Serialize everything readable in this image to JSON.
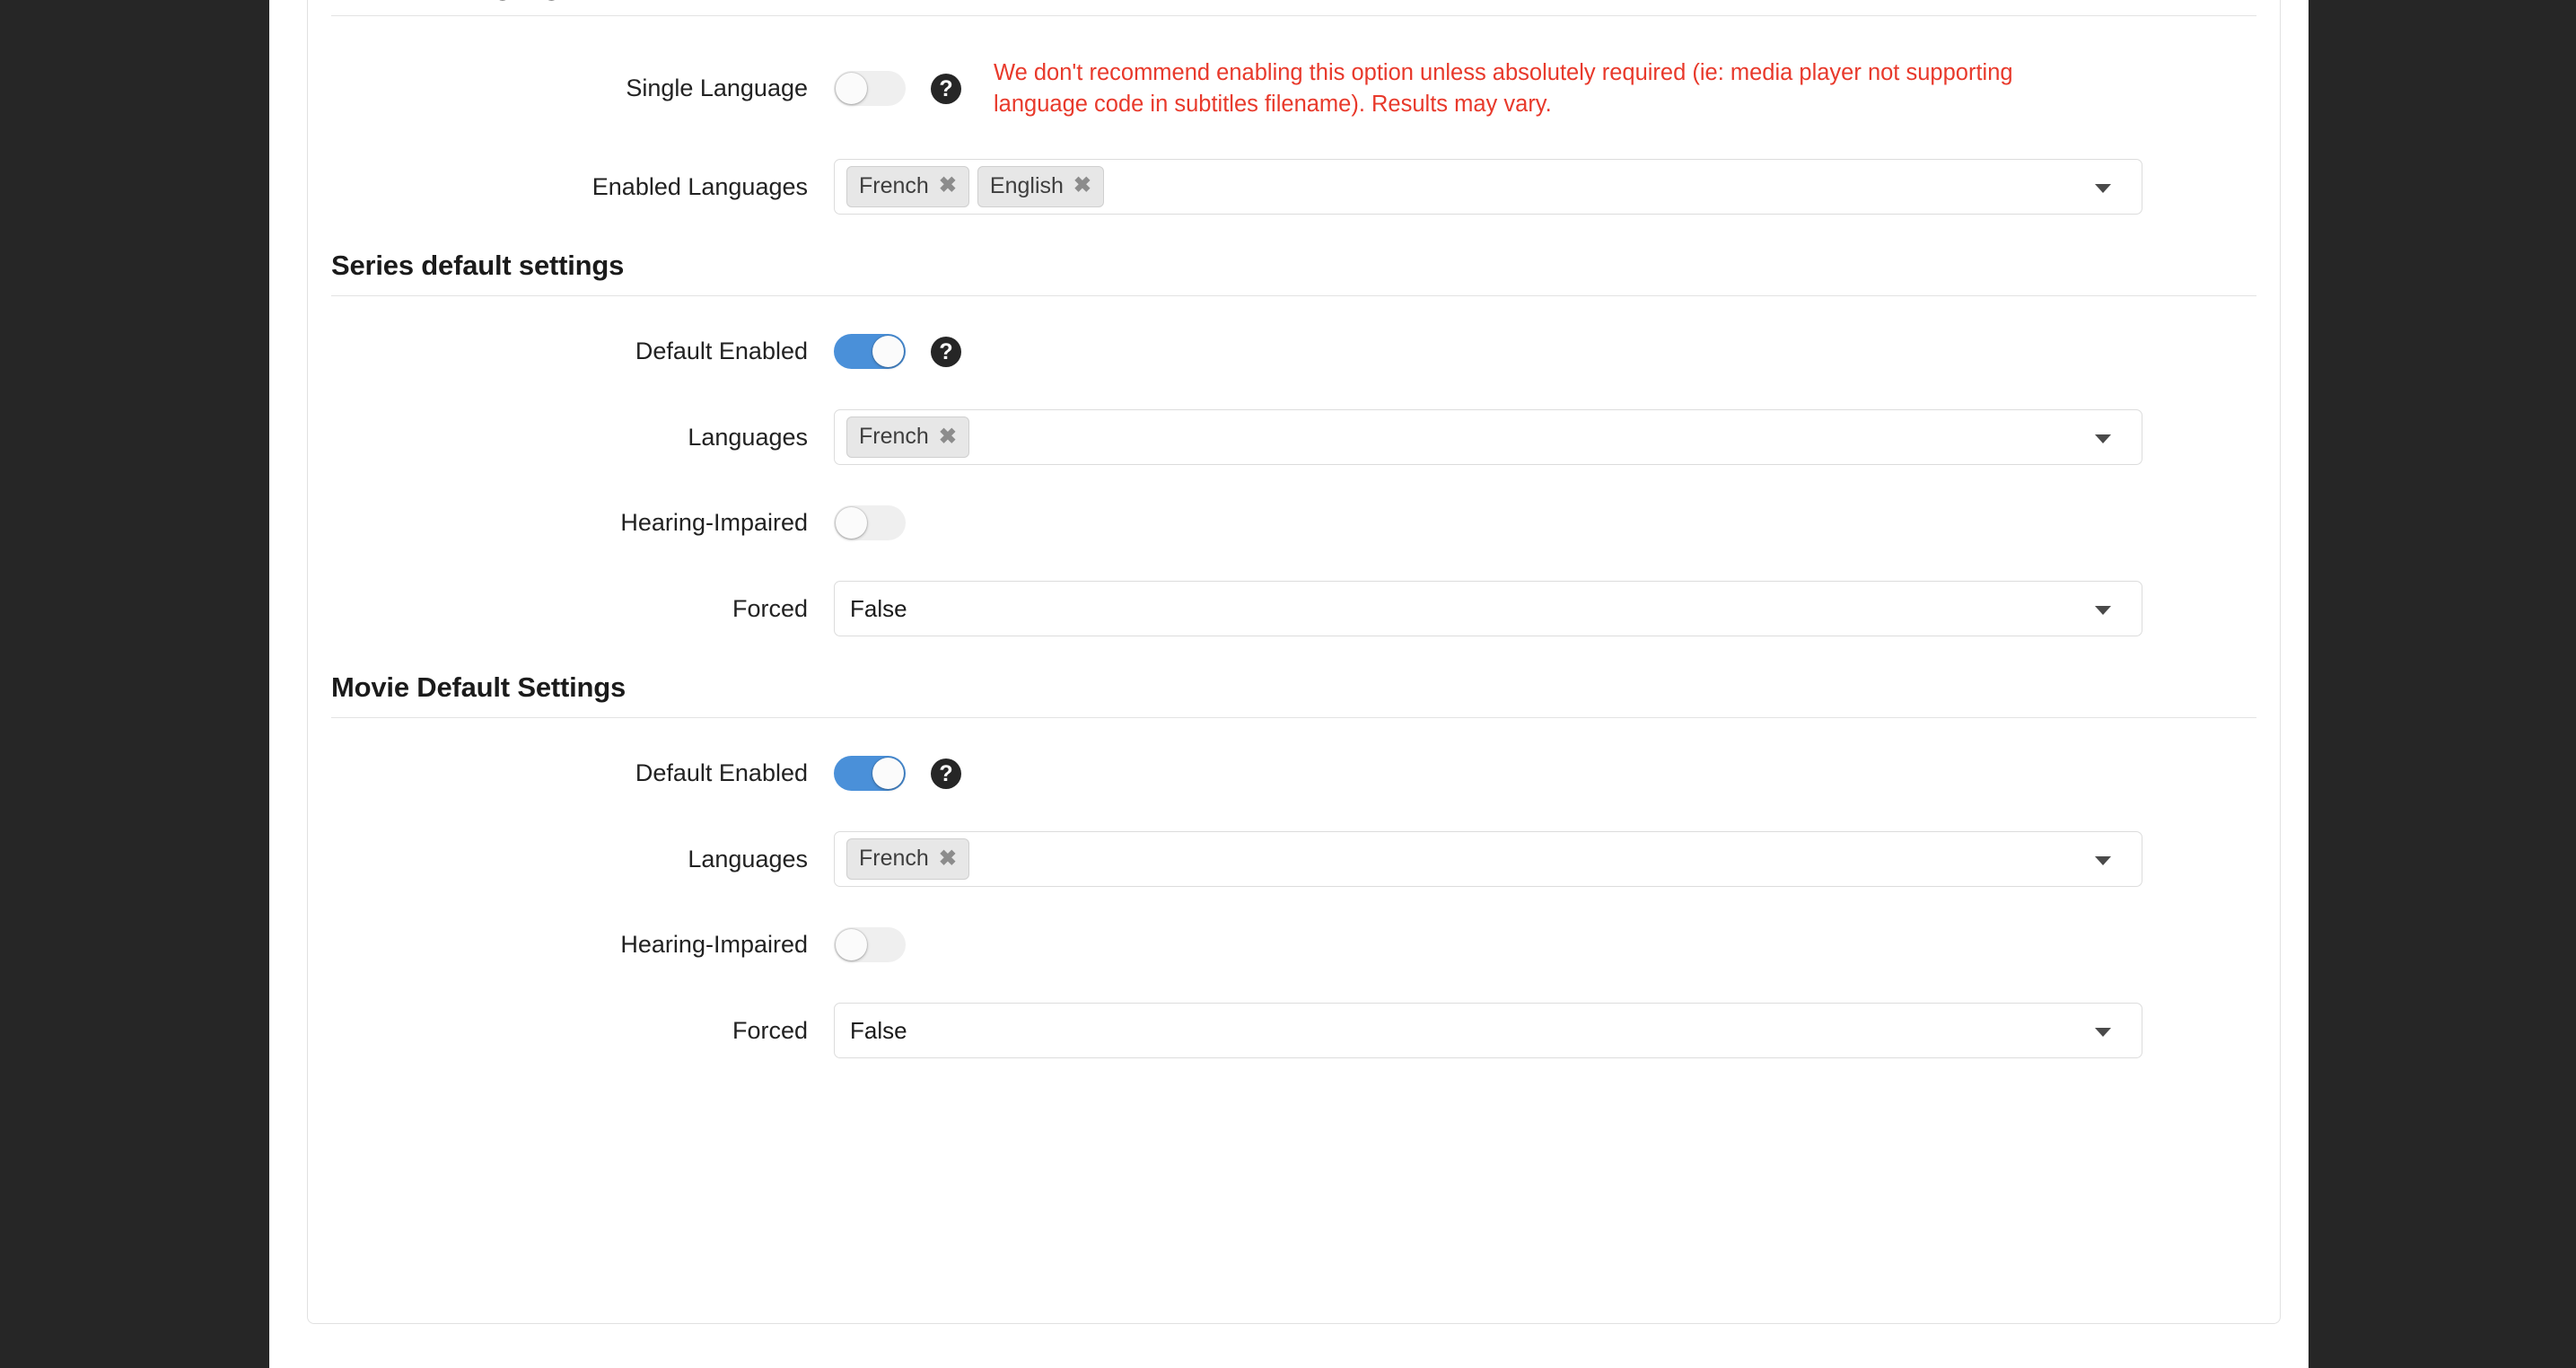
{
  "theme": {
    "rail_color": "#262626",
    "accent_on": "#4a90d9",
    "toggle_off": "#efefef",
    "danger_text": "#e8392b",
    "help_icon_bg": "#262626",
    "card_border": "#e1e1e1",
    "tag_bg": "#e7e7e7"
  },
  "sections": [
    {
      "id": "subtitles-languages",
      "title": "Subtitles languages",
      "rows": {
        "single_language": {
          "label": "Single Language",
          "toggle_state": "off",
          "help_icon": "question-mark-icon",
          "hint": "We don't recommend enabling this option unless absolutely required (ie: media player not supporting language code in subtitles filename). Results may vary."
        },
        "enabled_languages": {
          "label": "Enabled Languages",
          "tags": [
            "French",
            "English"
          ],
          "remove_glyph": "✖",
          "caret_icon": "chevron-down-icon"
        }
      }
    },
    {
      "id": "series-default-settings",
      "title": "Series default settings",
      "rows": {
        "default_enabled": {
          "label": "Default Enabled",
          "toggle_state": "on",
          "help_icon": "question-mark-icon"
        },
        "languages": {
          "label": "Languages",
          "tags": [
            "French"
          ],
          "remove_glyph": "✖",
          "caret_icon": "chevron-down-icon"
        },
        "hearing_impaired": {
          "label": "Hearing-Impaired",
          "toggle_state": "off"
        },
        "forced": {
          "label": "Forced",
          "value": "False",
          "caret_icon": "chevron-down-icon"
        }
      }
    },
    {
      "id": "movie-default-settings",
      "title": "Movie Default Settings",
      "rows": {
        "default_enabled": {
          "label": "Default Enabled",
          "toggle_state": "on",
          "help_icon": "question-mark-icon"
        },
        "languages": {
          "label": "Languages",
          "tags": [
            "French"
          ],
          "remove_glyph": "✖",
          "caret_icon": "chevron-down-icon"
        },
        "hearing_impaired": {
          "label": "Hearing-Impaired",
          "toggle_state": "off"
        },
        "forced": {
          "label": "Forced",
          "value": "False",
          "caret_icon": "chevron-down-icon"
        }
      }
    }
  ],
  "help_glyph": "?"
}
